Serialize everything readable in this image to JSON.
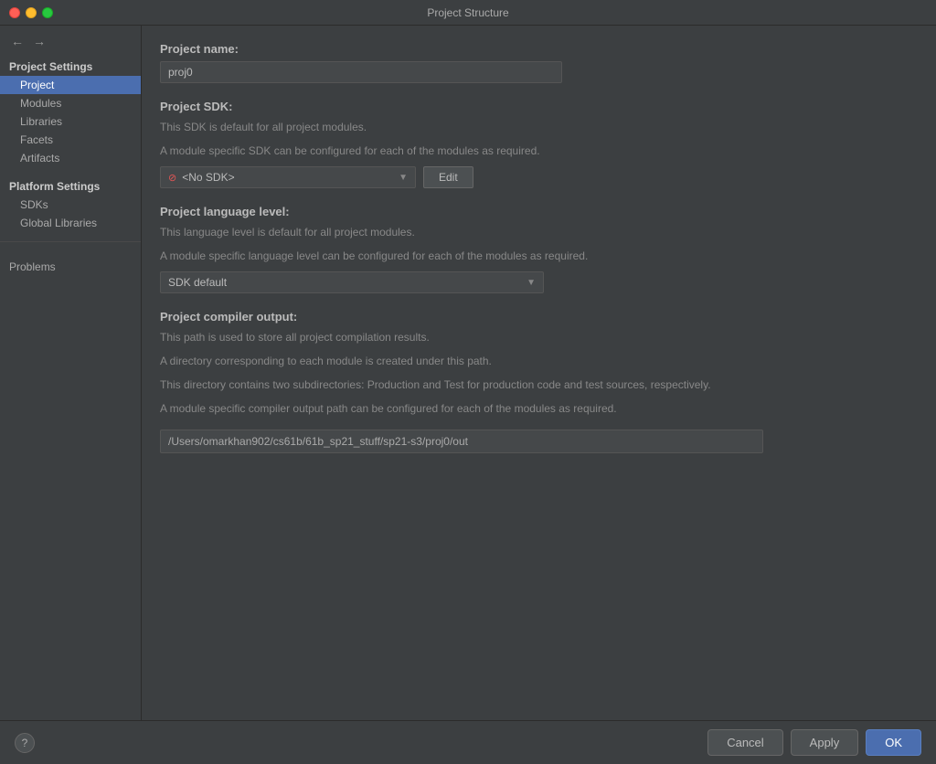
{
  "window": {
    "title": "Project Structure"
  },
  "sidebar": {
    "back_label": "←",
    "forward_label": "→",
    "project_settings_label": "Project Settings",
    "items": [
      {
        "id": "project",
        "label": "Project",
        "active": true
      },
      {
        "id": "modules",
        "label": "Modules",
        "active": false
      },
      {
        "id": "libraries",
        "label": "Libraries",
        "active": false
      },
      {
        "id": "facets",
        "label": "Facets",
        "active": false
      },
      {
        "id": "artifacts",
        "label": "Artifacts",
        "active": false
      }
    ],
    "platform_settings_label": "Platform Settings",
    "platform_items": [
      {
        "id": "sdks",
        "label": "SDKs",
        "active": false
      },
      {
        "id": "global-libraries",
        "label": "Global Libraries",
        "active": false
      }
    ],
    "problems_label": "Problems"
  },
  "content": {
    "project_name_label": "Project name:",
    "project_name_value": "proj0",
    "project_sdk_label": "Project SDK:",
    "sdk_desc1": "This SDK is default for all project modules.",
    "sdk_desc2": "A module specific SDK can be configured for each of the modules as required.",
    "sdk_selected": "<No SDK>",
    "sdk_icon": "⊘",
    "edit_label": "Edit",
    "project_language_label": "Project language level:",
    "lang_desc1": "This language level is default for all project modules.",
    "lang_desc2": "A module specific language level can be configured for each of the modules as required.",
    "language_selected": "SDK default",
    "project_compiler_label": "Project compiler output:",
    "compiler_desc1": "This path is used to store all project compilation results.",
    "compiler_desc2": "A directory corresponding to each module is created under this path.",
    "compiler_desc3": "This directory contains two subdirectories: Production and Test for production code and test sources, respectively.",
    "compiler_desc4": "A module specific compiler output path can be configured for each of the modules as required.",
    "compiler_path": "/Users/omarkhan902/cs61b/61b_sp21_stuff/sp21-s3/proj0/out"
  },
  "footer": {
    "help_label": "?",
    "cancel_label": "Cancel",
    "apply_label": "Apply",
    "ok_label": "OK"
  }
}
